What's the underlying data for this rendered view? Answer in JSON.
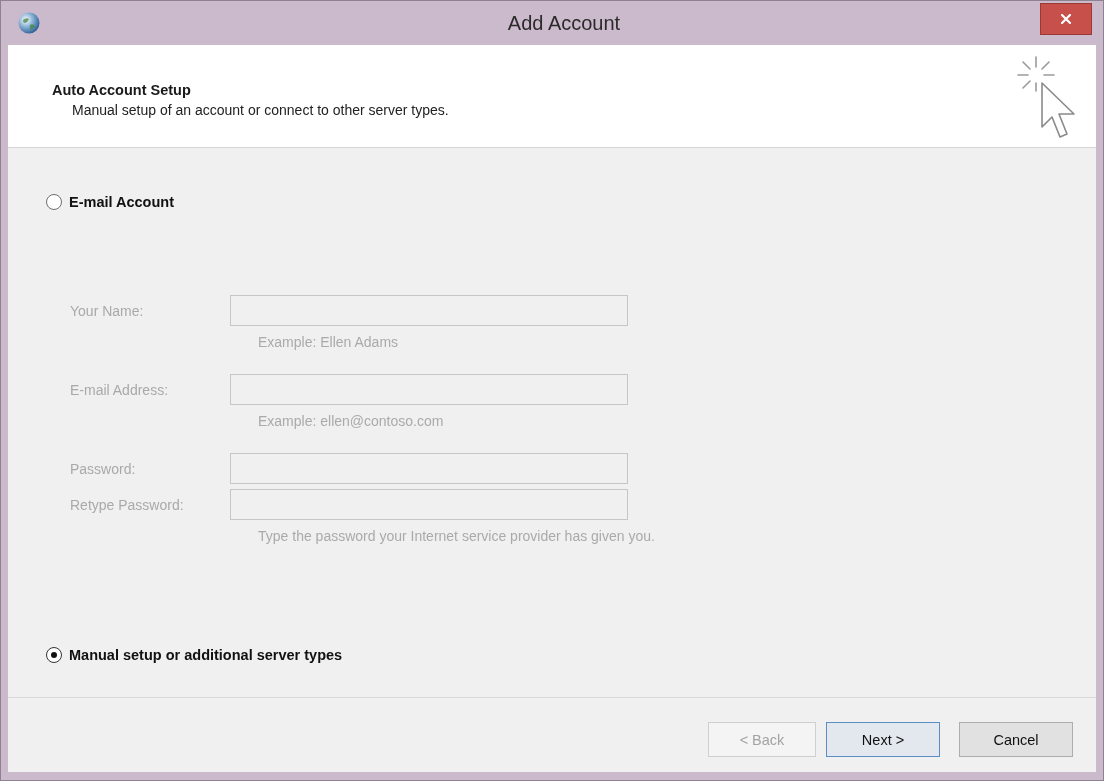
{
  "window": {
    "title": "Add Account"
  },
  "header": {
    "title": "Auto Account Setup",
    "subtitle": "Manual setup of an account or connect to other server types."
  },
  "options": [
    {
      "label": "E-mail Account",
      "selected": false,
      "fields": [
        {
          "label": "Your Name:",
          "hint": "Example: Ellen Adams"
        },
        {
          "label": "E-mail Address:",
          "hint": "Example: ellen@contoso.com"
        },
        {
          "label": "Password:"
        },
        {
          "label": "Retype Password:",
          "hint": "Type the password your Internet service provider has given you."
        }
      ]
    },
    {
      "label": "Manual setup or additional server types",
      "selected": true
    }
  ],
  "buttons": [
    {
      "label": "< Back",
      "disabled": true,
      "default": false
    },
    {
      "label": "Next >",
      "disabled": false,
      "default": true
    },
    {
      "label": "Cancel",
      "disabled": false,
      "default": false
    }
  ]
}
